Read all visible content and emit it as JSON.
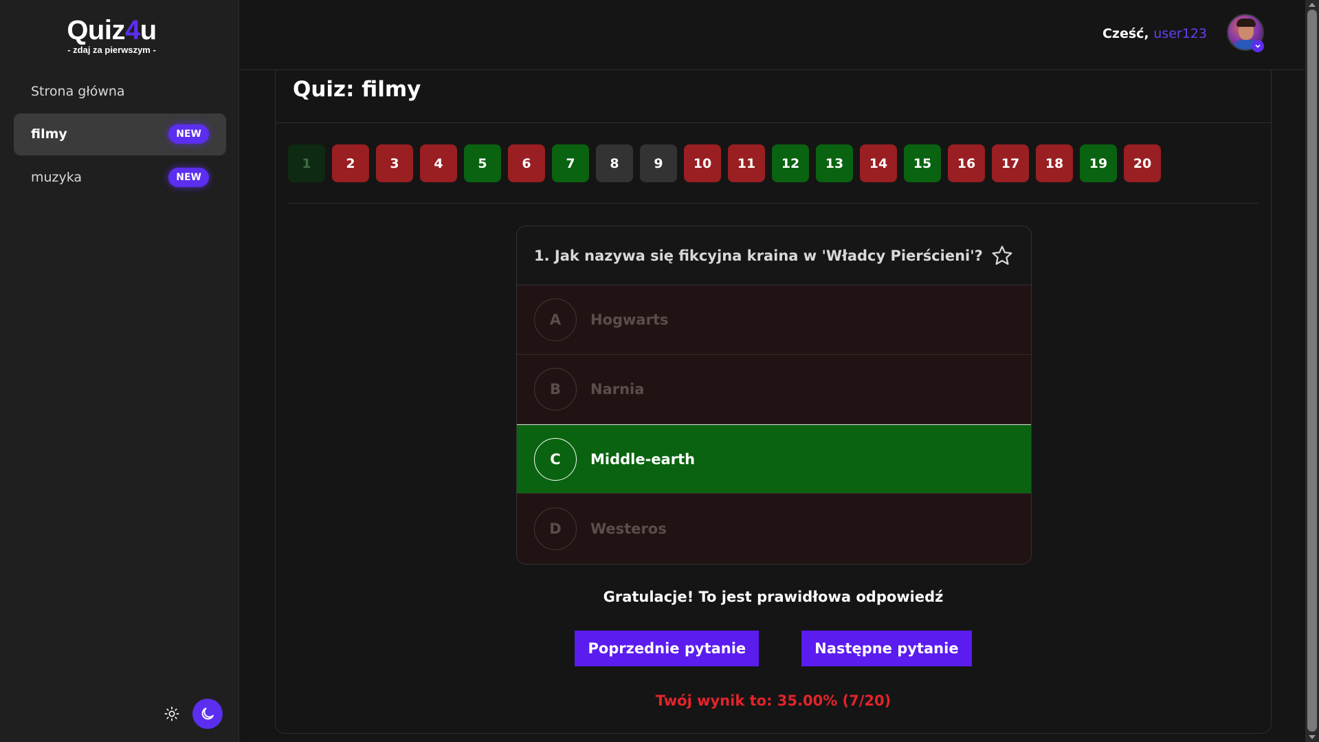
{
  "logo": {
    "part1": "Quiz",
    "part2": "4",
    "part3": "u",
    "tagline": "- zdaj za pierwszym -"
  },
  "sidebar": {
    "items": [
      {
        "label": "Strona główna",
        "badge": ""
      },
      {
        "label": "filmy",
        "badge": "NEW",
        "active": true
      },
      {
        "label": "muzyka",
        "badge": "NEW"
      }
    ]
  },
  "theme": {
    "light_icon": "sun-icon",
    "dark_icon": "moon-icon"
  },
  "header": {
    "greeting": "Cześć,",
    "username": "user123"
  },
  "quiz": {
    "title": "Quiz: filmy",
    "questions": [
      {
        "n": "1",
        "state": "current"
      },
      {
        "n": "2",
        "state": "wrong"
      },
      {
        "n": "3",
        "state": "wrong"
      },
      {
        "n": "4",
        "state": "wrong"
      },
      {
        "n": "5",
        "state": "correct"
      },
      {
        "n": "6",
        "state": "wrong"
      },
      {
        "n": "7",
        "state": "correct"
      },
      {
        "n": "8",
        "state": "unanswered"
      },
      {
        "n": "9",
        "state": "unanswered"
      },
      {
        "n": "10",
        "state": "wrong"
      },
      {
        "n": "11",
        "state": "wrong"
      },
      {
        "n": "12",
        "state": "correct"
      },
      {
        "n": "13",
        "state": "correct"
      },
      {
        "n": "14",
        "state": "wrong"
      },
      {
        "n": "15",
        "state": "correct"
      },
      {
        "n": "16",
        "state": "wrong"
      },
      {
        "n": "17",
        "state": "wrong"
      },
      {
        "n": "18",
        "state": "wrong"
      },
      {
        "n": "19",
        "state": "correct"
      },
      {
        "n": "20",
        "state": "wrong"
      }
    ],
    "question_text": "1. Jak nazywa się fikcyjna kraina w 'Władcy Pierścieni'?",
    "answers": [
      {
        "letter": "A",
        "text": "Hogwarts"
      },
      {
        "letter": "B",
        "text": "Narnia"
      },
      {
        "letter": "C",
        "text": "Middle-earth",
        "correct": true
      },
      {
        "letter": "D",
        "text": "Westeros"
      }
    ],
    "feedback": "Gratulacje! To jest prawidłowa odpowiedź",
    "prev_label": "Poprzednie pytanie",
    "next_label": "Następne pytanie",
    "score": "Twój wynik to: 35.00% (7/20)"
  },
  "colors": {
    "accent": "#5b2ef0",
    "wrong": "#9a1f22",
    "correct": "#0a6310",
    "unanswered": "#333333",
    "score": "#e3242b"
  }
}
